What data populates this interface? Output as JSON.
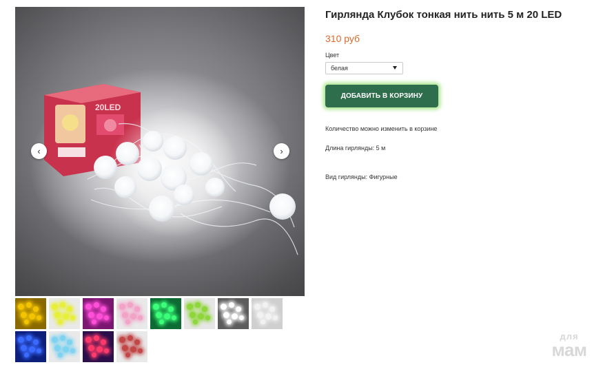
{
  "gallery": {
    "prev_arrow": "‹",
    "next_arrow": "›",
    "main_image_box_text": "20LED",
    "thumbnails": [
      {
        "color": "#f2c400",
        "bg": "#8a6a00"
      },
      {
        "color": "#e8ef3a",
        "bg": "#e9e9e9"
      },
      {
        "color": "#ff4fd8",
        "bg": "#7a1770"
      },
      {
        "color": "#f3a3c8",
        "bg": "#e9e9e9"
      },
      {
        "color": "#3cff7a",
        "bg": "#0d6b33"
      },
      {
        "color": "#8fd63a",
        "bg": "#e6e6e6"
      },
      {
        "color": "#ffffff",
        "bg": "#5c5c5c"
      },
      {
        "color": "#f2f2f2",
        "bg": "#cfcfcf"
      },
      {
        "color": "#3b6bff",
        "bg": "#0c1f7a"
      },
      {
        "color": "#7fd3f0",
        "bg": "#e9e9e9"
      },
      {
        "color": "#ff3b6b",
        "bg": "#2a0f4a"
      },
      {
        "color": "#c24848",
        "bg": "#e9e9e9"
      }
    ]
  },
  "product": {
    "title": "Гирлянда Клубок тонкая нить нить 5 м 20 LED",
    "price": "310 руб",
    "color_label": "Цвет",
    "color_value": "белая",
    "add_to_cart": "ДОБАВИТЬ В КОРЗИНУ",
    "quantity_note": "Количество можно изменить в корзине",
    "length": "Длина гирлянды: 5 м",
    "type": "Вид гирлянды: Фигурные"
  },
  "watermark": {
    "line1": "для",
    "line2": "мам"
  }
}
